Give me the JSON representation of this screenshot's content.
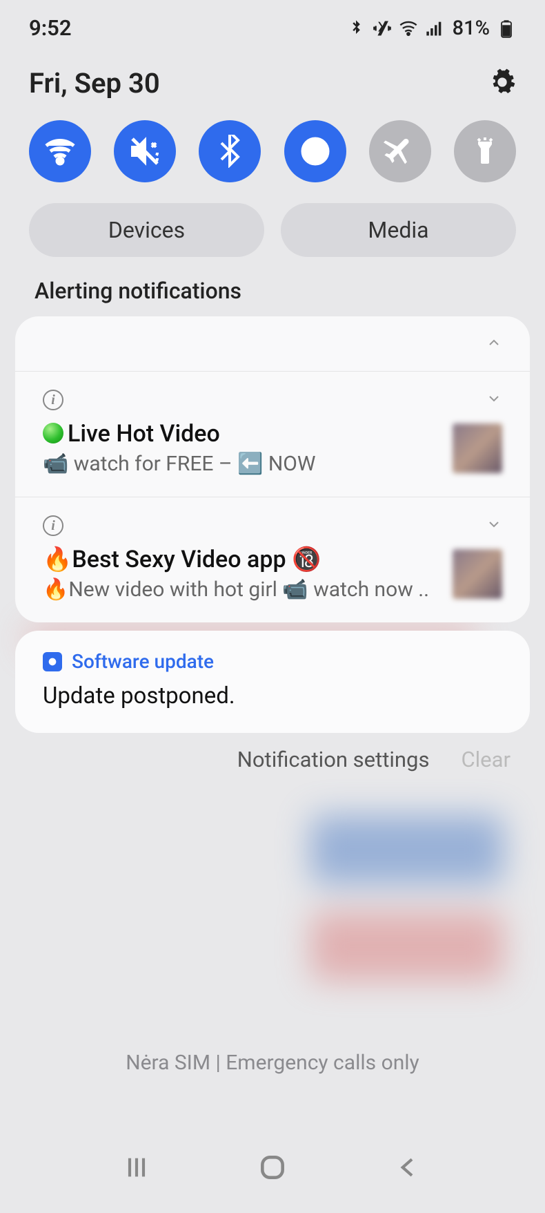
{
  "status": {
    "time": "9:52",
    "battery": "81%"
  },
  "date": "Fri, Sep 30",
  "qs": {
    "devices": "Devices",
    "media": "Media"
  },
  "section_label": "Alerting notifications",
  "notifications": [
    {
      "title": "🟢 Live Hot Video",
      "subtitle": "📹 watch for FREE – ⬅️ NOW"
    },
    {
      "title": "🔥Best Sexy Video app 🔞",
      "subtitle": "🔥New video with hot girl 📹 watch now .."
    }
  ],
  "system_notif": {
    "app": "Software update",
    "title": "Update postponed."
  },
  "footer": {
    "settings": "Notification settings",
    "clear": "Clear"
  },
  "sim": "Nėra SIM | Emergency calls only"
}
